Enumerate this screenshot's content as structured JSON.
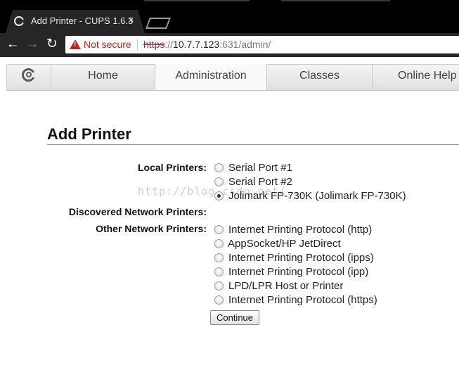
{
  "browser": {
    "tab_title": "Add Printer - CUPS 1.6.3",
    "tab_close": "×",
    "back_icon": "←",
    "forward_icon": "→",
    "reload_icon": "↻",
    "security_label": "Not secure",
    "url_scheme": "https",
    "url_separator": "://",
    "url_host": "10.7.7.123",
    "url_rest": ":631/admin/"
  },
  "nav": {
    "tabs": [
      {
        "label": "Home"
      },
      {
        "label": "Administration"
      },
      {
        "label": "Classes"
      },
      {
        "label": "Online Help"
      }
    ],
    "active_tab": "Administration"
  },
  "page": {
    "title": "Add Printer",
    "watermark": "http://blog.csdn.net/..."
  },
  "form": {
    "local_label": "Local Printers:",
    "local_options": [
      {
        "label": "Serial Port #1",
        "selected": false
      },
      {
        "label": "Serial Port #2",
        "selected": false
      },
      {
        "label": "Jolimark FP-730K (Jolimark FP-730K)",
        "selected": true
      }
    ],
    "discovered_label": "Discovered Network Printers:",
    "other_label": "Other Network Printers:",
    "other_options": [
      {
        "label": "Internet Printing Protocol (http)",
        "selected": false
      },
      {
        "label": "AppSocket/HP JetDirect",
        "selected": false
      },
      {
        "label": "Internet Printing Protocol (ipps)",
        "selected": false
      },
      {
        "label": "Internet Printing Protocol (ipp)",
        "selected": false
      },
      {
        "label": "LPD/LPR Host or Printer",
        "selected": false
      },
      {
        "label": "Internet Printing Protocol (https)",
        "selected": false
      }
    ],
    "continue_label": "Continue"
  },
  "colors": {
    "warning_red": "#c5221f",
    "chrome_dark": "#262626"
  }
}
